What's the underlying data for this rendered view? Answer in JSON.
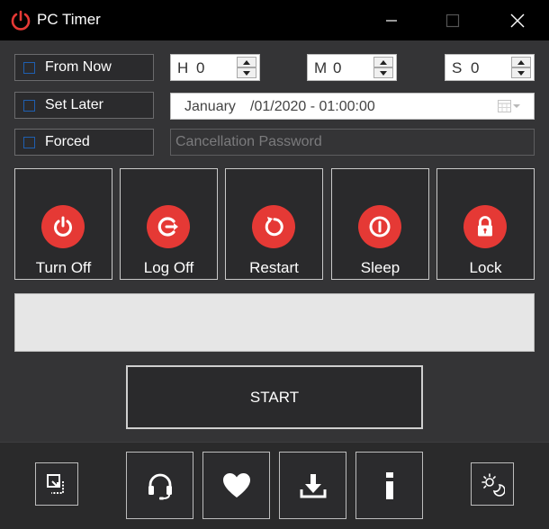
{
  "window": {
    "title": "PC Timer"
  },
  "options": {
    "from_now": "From Now",
    "set_later": "Set Later",
    "forced": "Forced"
  },
  "timer": {
    "hours": {
      "prefix": "H",
      "value": "0"
    },
    "minutes": {
      "prefix": "M",
      "value": "0"
    },
    "seconds": {
      "prefix": "S",
      "value": "0"
    }
  },
  "schedule": {
    "month": "January",
    "rest": "/01/2020 - 01:00:00"
  },
  "password": {
    "placeholder": "Cancellation Password"
  },
  "actions": [
    {
      "label": "Turn Off",
      "icon": "power-icon"
    },
    {
      "label": "Log Off",
      "icon": "logoff-icon"
    },
    {
      "label": "Restart",
      "icon": "restart-icon"
    },
    {
      "label": "Sleep",
      "icon": "sleep-icon"
    },
    {
      "label": "Lock",
      "icon": "lock-icon"
    }
  ],
  "start": {
    "label": "START"
  },
  "colors": {
    "accent": "#e53935",
    "background": "#343436",
    "titlebar": "#000000"
  }
}
